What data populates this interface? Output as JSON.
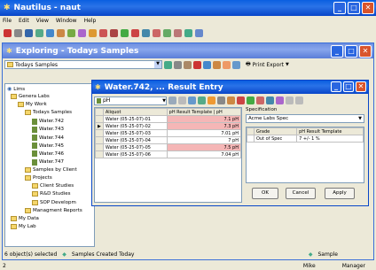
{
  "main_window": {
    "title": "Nautilus - naut",
    "menu": [
      "File",
      "Edit",
      "View",
      "Window",
      "Help"
    ]
  },
  "explorer": {
    "title": "Exploring - Todays Samples",
    "combo_value": "Todays Samples",
    "print_export": "Print Export"
  },
  "tree": {
    "root": "Lims",
    "items": [
      {
        "label": "Genera Labs",
        "indent": 0
      },
      {
        "label": "My Work",
        "indent": 1
      },
      {
        "label": "Todays Samples",
        "indent": 2
      },
      {
        "label": "Water.742",
        "indent": 3
      },
      {
        "label": "Water.743",
        "indent": 3
      },
      {
        "label": "Water.744",
        "indent": 3
      },
      {
        "label": "Water.745",
        "indent": 3
      },
      {
        "label": "Water.746",
        "indent": 3
      },
      {
        "label": "Water.747",
        "indent": 3
      },
      {
        "label": "Samples by Client",
        "indent": 2
      },
      {
        "label": "Projects",
        "indent": 2
      },
      {
        "label": "Client Studies",
        "indent": 3
      },
      {
        "label": "R&D Studies",
        "indent": 3
      },
      {
        "label": "SOP Developm",
        "indent": 3
      },
      {
        "label": "Managment Reports",
        "indent": 2
      },
      {
        "label": "My Data",
        "indent": 0
      },
      {
        "label": "My Lab",
        "indent": 0
      }
    ]
  },
  "result_entry": {
    "title": "Water.742, ... Result Entry",
    "combo_value": "pH",
    "columns": [
      "Aliquot",
      "pH Result Template | pH"
    ],
    "rows": [
      {
        "aliquot": "Water (05-25-07)-01",
        "value": "7.1 pH",
        "flag": true,
        "selected": false
      },
      {
        "aliquot": "Water (05-25-07)-02",
        "value": "7.3 pH",
        "flag": true,
        "selected": true
      },
      {
        "aliquot": "Water (05-25-07)-03",
        "value": "7.01 pH",
        "flag": false,
        "selected": false
      },
      {
        "aliquot": "Water (05-25-07)-04",
        "value": "7 pH",
        "flag": false,
        "selected": false
      },
      {
        "aliquot": "Water (05-25-07)-05",
        "value": "7.5 pH",
        "flag": true,
        "selected": false
      },
      {
        "aliquot": "Water (05-25-07)-06",
        "value": "7.04 pH",
        "flag": false,
        "selected": false
      }
    ],
    "specification_label": "Specification",
    "specification_value": "Acme Labs Spec",
    "spec_columns": [
      "Grade",
      "pH Result Template"
    ],
    "spec_rows": [
      {
        "grade": "Out of Spec",
        "template": "7 +/- 1 %"
      }
    ],
    "buttons": {
      "ok": "OK",
      "cancel": "Cancel",
      "apply": "Apply"
    }
  },
  "explorer_status": {
    "selected": "6 object(s) selected",
    "created": "Samples Created Today",
    "sample": "Sample"
  },
  "app_status": {
    "left": "2",
    "user": "Mike",
    "role": "Manager"
  }
}
